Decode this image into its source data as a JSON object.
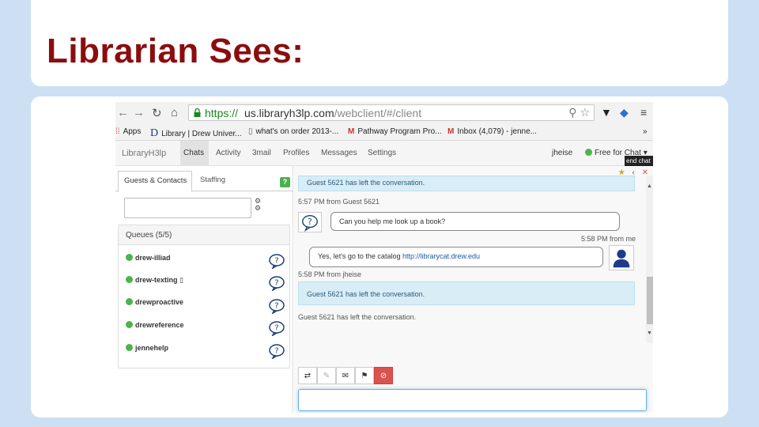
{
  "slide": {
    "title": "Librarian Sees:"
  },
  "browser": {
    "url_https": "https://",
    "url_host": "us.libraryh3lp.com",
    "url_path": "/webclient/#/client",
    "bookmarks": [
      {
        "label": "Apps",
        "icon": "apps-grid-icon"
      },
      {
        "label": "Library | Drew Univer...",
        "icon": "drew-d-icon"
      },
      {
        "label": "what's on order 2013-...",
        "icon": "page-icon"
      },
      {
        "label": "Pathway Program Pro...",
        "icon": "gmail-icon"
      },
      {
        "label": "Inbox (4,079) - jenne...",
        "icon": "gmail-icon"
      }
    ],
    "more": "»"
  },
  "app_nav": {
    "brand": "LibraryH3lp",
    "items": [
      "Chats",
      "Activity",
      "3mail",
      "Profiles",
      "Messages",
      "Settings"
    ],
    "active": "Chats",
    "user": "jheise",
    "status": "Free for Chat",
    "tooltip": "end chat"
  },
  "left": {
    "tabs": [
      "Guests & Contacts",
      "Staffing"
    ],
    "help": "?",
    "queues_header": "Queues (5/5)",
    "queues": [
      {
        "name": "drew-illiad",
        "status": "online"
      },
      {
        "name": "drew-texting",
        "status": "online",
        "extra": "phone-icon"
      },
      {
        "name": "drewproactive",
        "status": "online"
      },
      {
        "name": "drewreference",
        "status": "online"
      },
      {
        "name": "jennehelp",
        "status": "online"
      }
    ]
  },
  "chat": {
    "sys_top": "Guest 5621 has left the conversation.",
    "meta_guest": "5:57 PM from Guest 5621",
    "guest_msg": "Can you help me look up a book?",
    "meta_me": "5:58 PM from me",
    "me_msg_prefix": "Yes, let's go to the catalog ",
    "me_msg_link": "http://librarycat.drew.edu",
    "meta_jheise": "5:58 PM from jheise",
    "sys_mid": "Guest 5621 has left the conversation.",
    "sys_plain": "Guest 5621 has left the conversation."
  },
  "colors": {
    "title": "#8b0d0d",
    "online": "#48b648",
    "sys_bg": "#d9edf7",
    "danger": "#d9534f"
  }
}
